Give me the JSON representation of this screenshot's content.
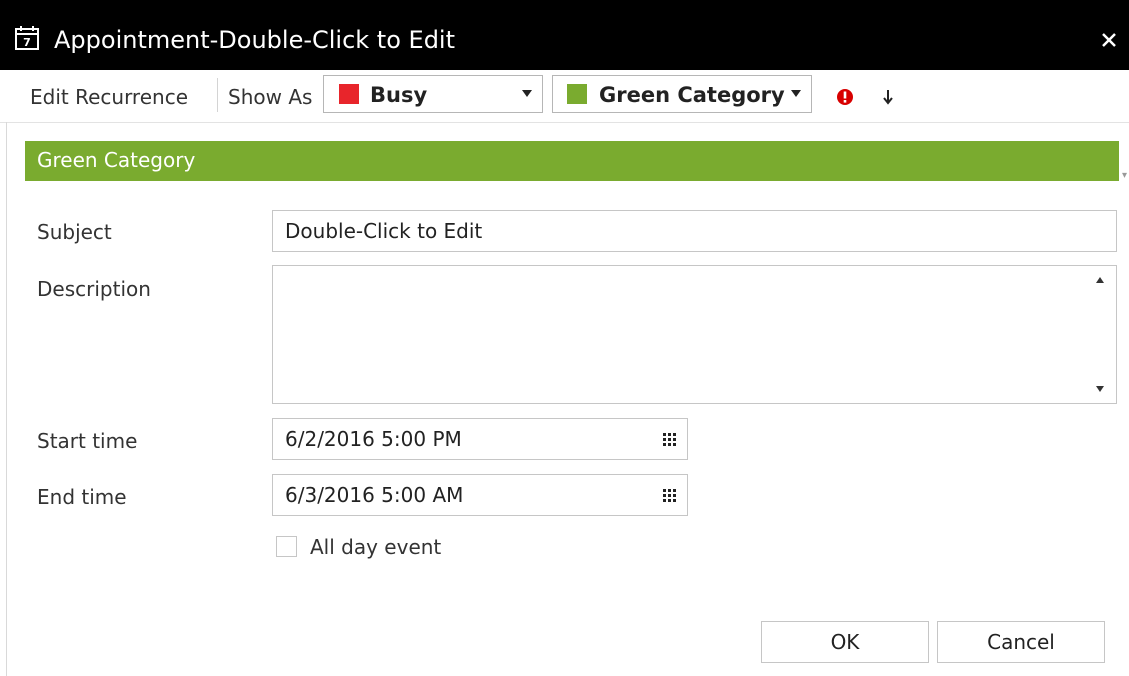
{
  "window": {
    "title": "Appointment-Double-Click to Edit",
    "icon": "calendar-icon",
    "close_icon": "close-icon"
  },
  "toolbar": {
    "edit_recurrence": "Edit Recurrence",
    "show_as_label": "Show As",
    "show_as_value": "Busy",
    "show_as_color": "#e8252b",
    "category_value": "Green Category",
    "category_color": "#7aab2f",
    "high_importance_icon": "high-importance-icon",
    "high_importance_color": "#d80000",
    "low_importance_icon": "low-importance-icon"
  },
  "category_banner": {
    "label": "Green Category",
    "color": "#7aab2f"
  },
  "form": {
    "subject_label": "Subject",
    "subject_value": "Double-Click to Edit",
    "description_label": "Description",
    "description_value": "",
    "start_label": "Start time",
    "start_value": "6/2/2016 5:00 PM",
    "end_label": "End time",
    "end_value": "6/3/2016 5:00 AM",
    "all_day_label": "All day event",
    "all_day_checked": false
  },
  "buttons": {
    "ok": "OK",
    "cancel": "Cancel"
  }
}
